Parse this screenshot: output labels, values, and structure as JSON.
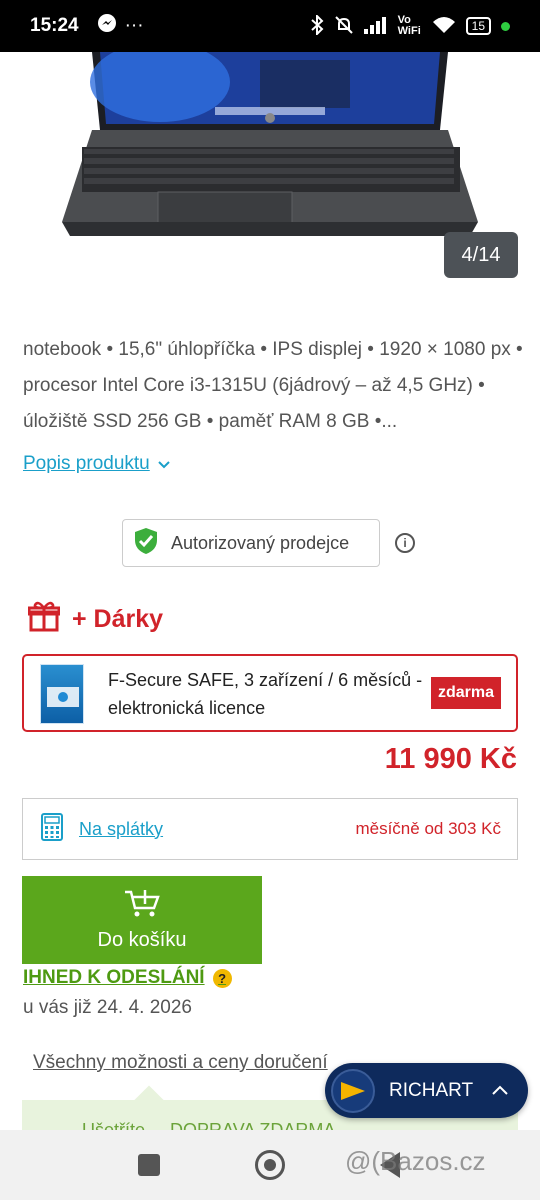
{
  "statusbar": {
    "time": "15:24",
    "messenger_icon": "messenger-icon",
    "more": "···",
    "network": "Vo WiFi",
    "battery": "15",
    "colors": {
      "dot": "#2ecc40"
    }
  },
  "gallery": {
    "counter": "4/14"
  },
  "description": {
    "text": "notebook • 15,6\" úhlopříčka • IPS displej • 1920 × 1080 px • procesor Intel Core i3-1315U (6jádrový – až 4,5 GHz) • úložiště SSD 256 GB • paměť RAM 8 GB •...",
    "link": "Popis produktu"
  },
  "seller": {
    "label": "Autorizovaný prodejce"
  },
  "gifts": {
    "title": "+ Dárky",
    "item": "F-Secure SAFE, 3 zařízení / 6 měsíců - elektronická licence",
    "badge": "zdarma"
  },
  "price": "11 990 Kč",
  "installments": {
    "link": "Na splátky",
    "monthly": "měsíčně od 303 Kč"
  },
  "cart": {
    "label": "Do košíku"
  },
  "availability": {
    "status": "IHNED K ODESLÁNÍ",
    "delivery": "u vás již 24. 4. 2026",
    "all_options": "Všechny možnosti a ceny doručení"
  },
  "promo": {
    "text": "Ušetříte ... DOPRAVA ZDARMA"
  },
  "chat": {
    "name": "RICHART"
  },
  "watermark": "@(Bazos.cz",
  "colors": {
    "brand_red": "#d1232a",
    "link_blue": "#1a9fc9",
    "cart_green": "#5ba71c",
    "chat_navy": "#0e2a5c"
  }
}
